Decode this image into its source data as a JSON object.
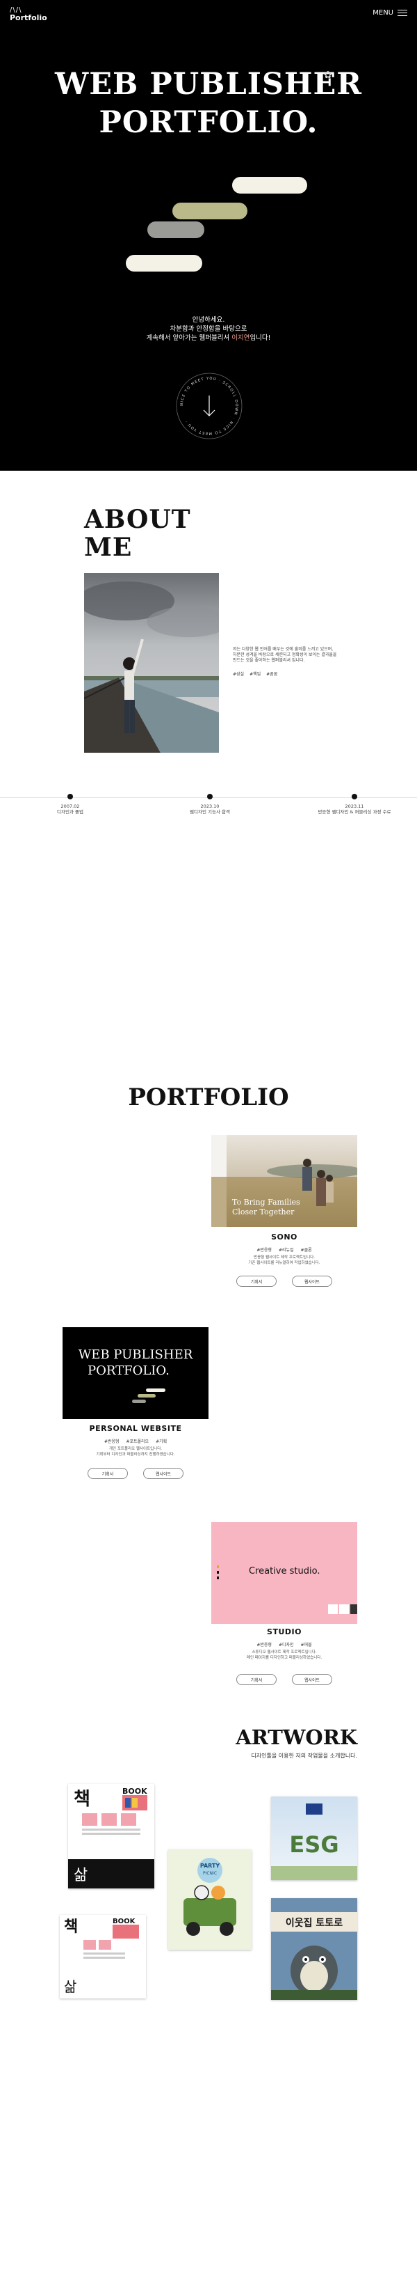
{
  "header": {
    "logo_mark": "/\\/\\",
    "logo_text": "Portfolio",
    "menu_label": "MENU"
  },
  "hero": {
    "title_line1": "WEB PUBLISHER",
    "title_line2": "PORTFOLIO.",
    "intro_line1": "안녕하세요.",
    "intro_line2": "차분함과 안정함을 바탕으로",
    "intro_line3_prefix": "계속해서 앞아가는 웹퍼블리셔 ",
    "intro_line3_accent": "이지연",
    "intro_line3_suffix": "입니다!",
    "scroll_ring_text": "NICE TO MEET YOU · SCROLL DOWN · NICE TO MEET YOU ·"
  },
  "about": {
    "title_line1": "ABOUT",
    "title_line2": "ME",
    "text_line1": "저는 다양한 웹 언어를 배우는 것에 흥미를 느끼고 있으며,",
    "text_line2": "차분한 성격을 바탕으로 세련되고 정확성이 보이는 결과물을",
    "text_line3": "만드는 것을 좋아하는 웹퍼블리셔 입니다.",
    "tags": [
      "#성실",
      "#책임",
      "#꼼꼼"
    ],
    "timeline": [
      {
        "date": "2007.02",
        "desc": "디자인과 졸업"
      },
      {
        "date": "2023.10",
        "desc": "웹디자인 기능사 합격"
      },
      {
        "date": "2023.11",
        "desc": "반응형 웹디자인 & 퍼블리싱 과정 수료"
      }
    ]
  },
  "portfolio": {
    "title": "PORTFOLIO",
    "projects": [
      {
        "name": "SONO",
        "image_caption_line1": "To Bring Families",
        "image_caption_line2": "Closer Together",
        "tags": [
          "#반응형",
          "#리뉴얼",
          "#클론"
        ],
        "desc_line1": "반응형 웹사이트 제작 프로젝트입니다.",
        "desc_line2": "기존 웹사이트를 리뉴얼하여 작업하였습니다.",
        "btn_plan": "기획서",
        "btn_site": "웹사이트"
      },
      {
        "name": "PERSONAL WEBSITE",
        "image_title_line1": "WEB PUBLISHER",
        "image_title_line2": "PORTFOLIO.",
        "tags": [
          "#반응형",
          "#포트폴리오",
          "#기획"
        ],
        "desc_line1": "개인 포트폴리오 웹사이트입니다.",
        "desc_line2": "기획부터 디자인과 퍼블리싱까지 진행하였습니다.",
        "btn_plan": "기획서",
        "btn_site": "웹사이트"
      },
      {
        "name": "STUDIO",
        "image_title": "Creative studio.",
        "tags": [
          "#반응형",
          "#디자인",
          "#퍼블"
        ],
        "desc_line1": "스튜디오 웹사이트 제작 프로젝트입니다.",
        "desc_line2": "메인 페이지를 디자인하고 퍼블리싱하였습니다.",
        "btn_plan": "기획서",
        "btn_site": "웹사이트"
      }
    ]
  },
  "artwork": {
    "title": "ARTWORK",
    "subtitle": "디자인툴을 이용한 저의 작업물을 소개합니다.",
    "items": [
      {
        "main": "책",
        "sub": "BOOK",
        "footer": "삶"
      },
      {
        "main": "ESG"
      },
      {
        "main": "PARTY",
        "sub": "PICNIC"
      },
      {
        "main": "책",
        "sub": "BOOK",
        "footer": "삶"
      },
      {
        "main": "이웃집 토토로"
      }
    ]
  },
  "colors": {
    "accent": "#ec9a8a",
    "studio_pink": "#f7b6c2",
    "pill_cream": "#f4f1e6",
    "pill_olive": "#b9b98a",
    "pill_gray": "#9a9a96"
  },
  "icons": [
    "menu-icon",
    "arrow-down-icon",
    "flower-icon"
  ]
}
